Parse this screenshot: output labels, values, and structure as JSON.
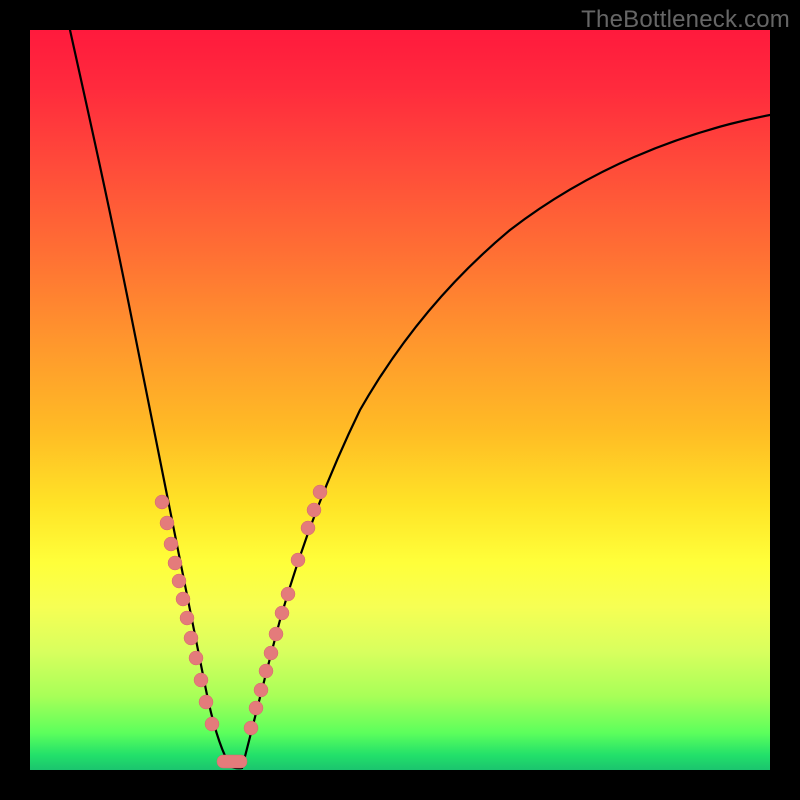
{
  "watermark": "TheBottleneck.com",
  "colors": {
    "dot": "#e47b7b",
    "curve": "#000000"
  },
  "chart_data": {
    "type": "line",
    "title": "",
    "xlabel": "",
    "ylabel": "",
    "xlim": [
      0,
      100
    ],
    "ylim": [
      0,
      100
    ],
    "grid": false,
    "legend": false,
    "description": "V-shaped bottleneck curve. Y is percent bottleneck (red=high at top, green=0 at bottom). Curve descends steeply from upper-left, reaches 0 near x≈26, then rises with diminishing slope toward upper-right. Salmon markers cluster near the valley on both sides; a short salmon segment sits at the valley floor.",
    "series": [
      {
        "name": "bottleneck-curve",
        "x": [
          5,
          8,
          10,
          12,
          14,
          16,
          18,
          20,
          22,
          24,
          25,
          26,
          27,
          28,
          30,
          33,
          36,
          40,
          45,
          50,
          55,
          60,
          66,
          72,
          80,
          88,
          96,
          100
        ],
        "y": [
          100,
          90,
          83,
          75,
          66,
          57,
          48,
          39,
          29,
          18,
          10,
          4,
          1,
          0,
          2,
          7,
          14,
          22,
          32,
          41,
          48,
          55,
          62,
          68,
          75,
          81,
          86,
          89
        ]
      }
    ],
    "markers_left": [
      {
        "x": 16.5,
        "y": 37
      },
      {
        "x": 17.2,
        "y": 34
      },
      {
        "x": 17.8,
        "y": 31
      },
      {
        "x": 18.2,
        "y": 28.5
      },
      {
        "x": 18.9,
        "y": 26
      },
      {
        "x": 19.4,
        "y": 23.5
      },
      {
        "x": 20.0,
        "y": 21
      },
      {
        "x": 20.7,
        "y": 18
      },
      {
        "x": 21.3,
        "y": 15.5
      },
      {
        "x": 22.0,
        "y": 12.5
      },
      {
        "x": 22.7,
        "y": 9.5
      },
      {
        "x": 23.5,
        "y": 6.5
      }
    ],
    "markers_right": [
      {
        "x": 28.2,
        "y": 6
      },
      {
        "x": 29.0,
        "y": 9
      },
      {
        "x": 29.5,
        "y": 11.5
      },
      {
        "x": 30.2,
        "y": 14
      },
      {
        "x": 30.8,
        "y": 16.5
      },
      {
        "x": 31.4,
        "y": 19
      },
      {
        "x": 32.2,
        "y": 22
      },
      {
        "x": 32.8,
        "y": 24.5
      },
      {
        "x": 34.0,
        "y": 29
      },
      {
        "x": 35.4,
        "y": 33.5
      },
      {
        "x": 36.0,
        "y": 36
      },
      {
        "x": 36.6,
        "y": 38.5
      }
    ],
    "valley_segment": {
      "x_from": 24.3,
      "x_to": 27.7,
      "y": 1.2
    }
  }
}
